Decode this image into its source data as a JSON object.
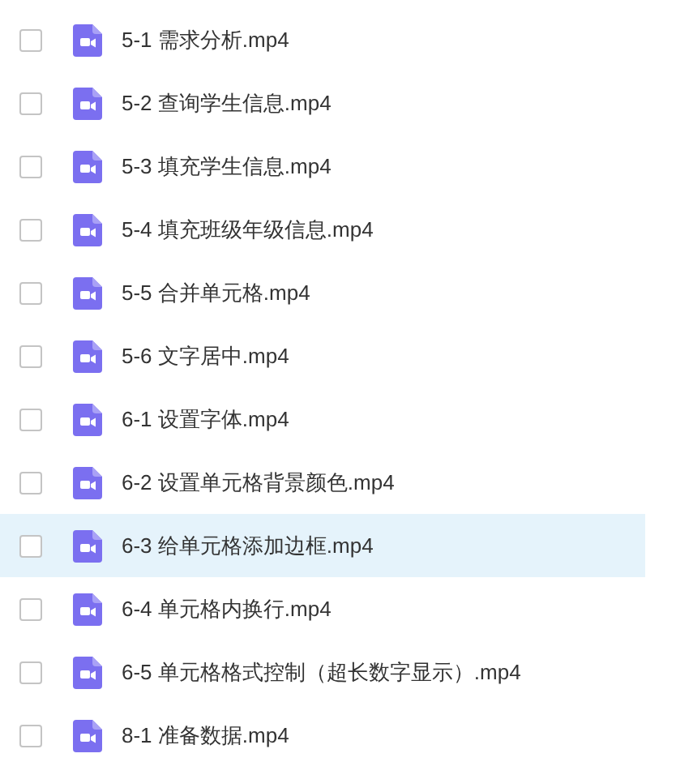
{
  "files": [
    {
      "name": "5-1 需求分析.mp4",
      "checked": false,
      "selected": false
    },
    {
      "name": "5-2 查询学生信息.mp4",
      "checked": false,
      "selected": false
    },
    {
      "name": "5-3 填充学生信息.mp4",
      "checked": false,
      "selected": false
    },
    {
      "name": "5-4 填充班级年级信息.mp4",
      "checked": false,
      "selected": false
    },
    {
      "name": "5-5 合并单元格.mp4",
      "checked": false,
      "selected": false
    },
    {
      "name": "5-6 文字居中.mp4",
      "checked": false,
      "selected": false
    },
    {
      "name": "6-1 设置字体.mp4",
      "checked": false,
      "selected": false
    },
    {
      "name": "6-2 设置单元格背景颜色.mp4",
      "checked": false,
      "selected": false
    },
    {
      "name": "6-3 给单元格添加边框.mp4",
      "checked": false,
      "selected": true
    },
    {
      "name": "6-4 单元格内换行.mp4",
      "checked": false,
      "selected": false
    },
    {
      "name": "6-5 单元格格式控制（超长数字显示）.mp4",
      "checked": false,
      "selected": false
    },
    {
      "name": "8-1 准备数据.mp4",
      "checked": false,
      "selected": false
    }
  ]
}
